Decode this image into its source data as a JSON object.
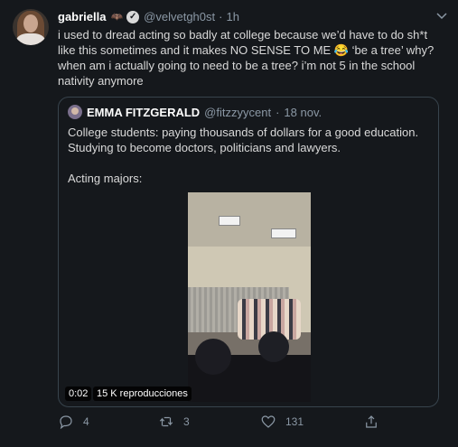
{
  "tweet": {
    "author_name": "gabriella",
    "author_handle": "@velvetgh0st",
    "separator": "·",
    "time": "1h",
    "text": "i used to dread acting so badly at college because we’d have to do sh*t like this sometimes and it makes NO SENSE TO ME 😂 ‘be a tree’ why? when am i actually going to need to be a tree? i’m not 5 in the school nativity anymore"
  },
  "quote": {
    "author_name": "EMMA FITZGERALD",
    "author_handle": "@fitzzyycent",
    "separator": "·",
    "date": "18 nov.",
    "line1": "College students: paying thousands of dollars for a good education. Studying to become doctors, politicians and lawyers.",
    "line2": "Acting majors:",
    "video": {
      "duration": "0:02",
      "views": "15 K reproducciones"
    }
  },
  "actions": {
    "reply_count": "4",
    "retweet_count": "3",
    "like_count": "131"
  },
  "icons": {
    "reply": "reply-icon",
    "retweet": "retweet-icon",
    "like": "heart-icon",
    "share": "share-icon",
    "more": "chevron-down-icon",
    "verified": "verified-badge-icon",
    "bat": "bat-emoji-icon"
  },
  "colors": {
    "background": "#15181c",
    "text": "#d9d9d9",
    "muted": "#8b98a5",
    "border": "#38444d"
  }
}
